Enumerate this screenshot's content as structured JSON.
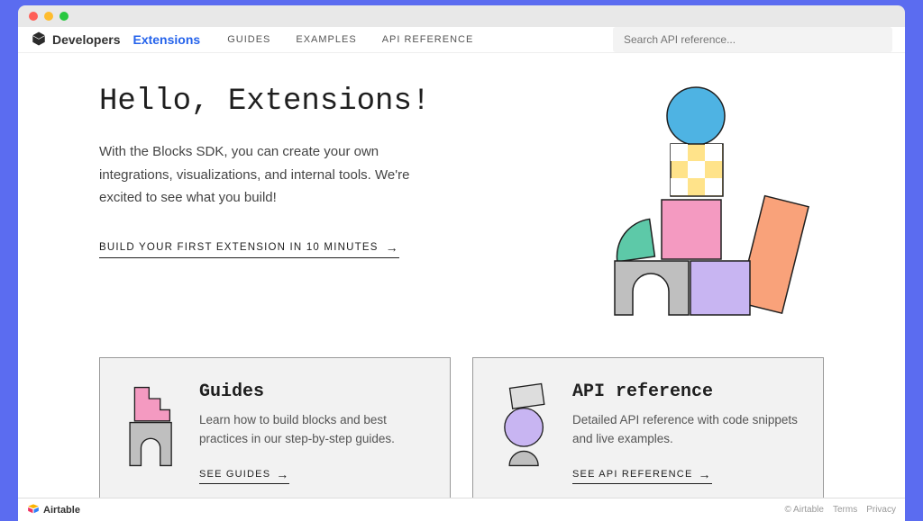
{
  "brand": "Developers",
  "product": "Extensions",
  "nav": {
    "guides": "GUIDES",
    "examples": "EXAMPLES",
    "api_ref": "API REFERENCE"
  },
  "search": {
    "placeholder": "Search API reference..."
  },
  "hero": {
    "title": "Hello, Extensions!",
    "desc": "With the Blocks SDK, you can create your own integrations, visualizations, and internal tools. We're excited to see what you build!",
    "cta": "BUILD YOUR FIRST EXTENSION IN 10 MINUTES"
  },
  "cards": {
    "guides": {
      "title": "Guides",
      "desc": "Learn how to build blocks and best practices in our step-by-step guides.",
      "link": "SEE GUIDES"
    },
    "api": {
      "title": "API reference",
      "desc": "Detailed API reference with code snippets and live examples.",
      "link": "SEE API REFERENCE"
    }
  },
  "footer": {
    "brand": "Airtable",
    "copyright": "© Airtable",
    "terms": "Terms",
    "privacy": "Privacy"
  }
}
